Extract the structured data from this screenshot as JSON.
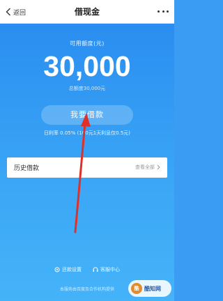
{
  "navbar": {
    "back_label": "返回",
    "title": "借现金"
  },
  "hero": {
    "available_label": "可用额度(元)",
    "amount": "30,000",
    "total_line": "总额度30,000元",
    "borrow_button": "我要借款",
    "rate_line": "日利率 0.05% (100元1天利息仅0.5元)"
  },
  "history": {
    "title": "历史借款",
    "view_all": "查看全部"
  },
  "footer": {
    "repay_settings": "还款设置",
    "customer_service": "客服中心",
    "footnote": "本服务由百度及合作机构提供"
  },
  "watermark": {
    "badge": "酷",
    "text": "酷知网"
  },
  "colors": {
    "hero_top": "#2a8df0",
    "hero_bottom": "#45b3f8",
    "arrow": "#e0302a"
  }
}
